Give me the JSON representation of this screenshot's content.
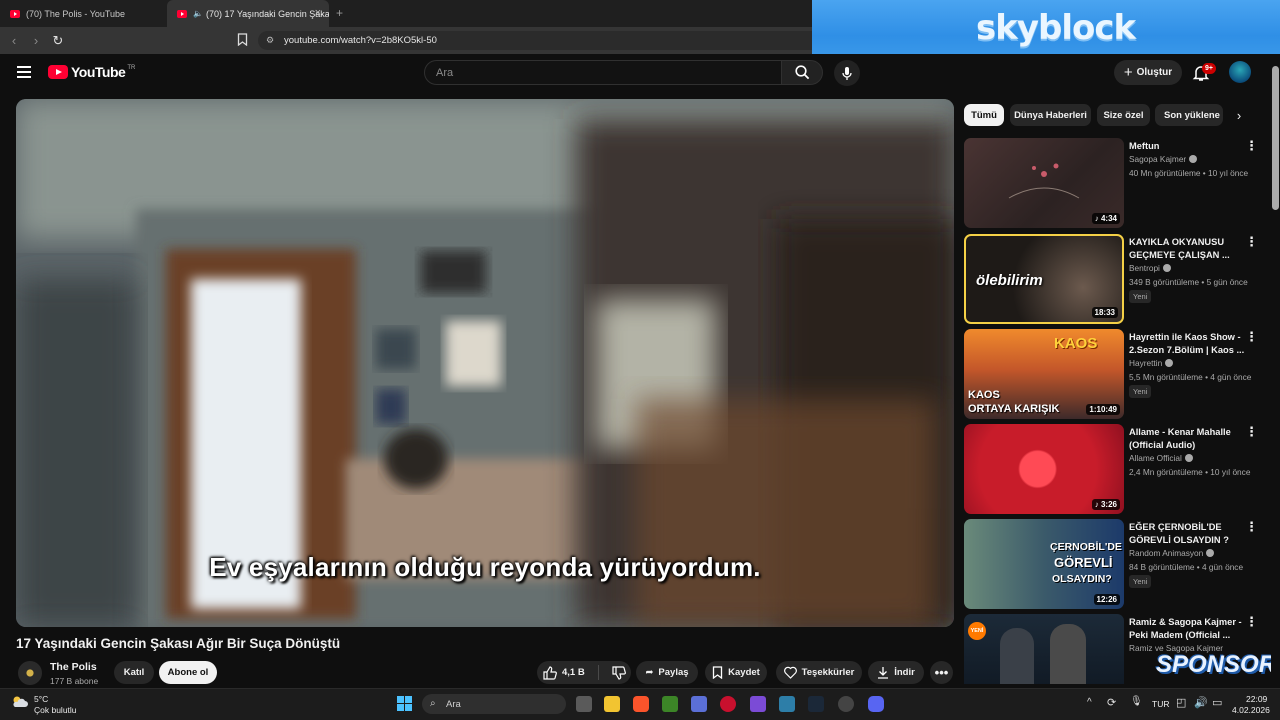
{
  "browser": {
    "tabs": [
      {
        "label": "(70) The Polis - YouTube"
      },
      {
        "label": "(70) 17 Yaşındaki Gencin Şaka"
      }
    ],
    "url": "youtube.com/watch?v=2b8KO5kl-50"
  },
  "overlay": {
    "skyblock_text": "skyblock",
    "sponsor_text": "SPONSOR"
  },
  "header": {
    "logo_text": "YouTube",
    "country_code": "TR",
    "search_placeholder": "Ara",
    "create_label": "Oluştur",
    "notification_count": "9+"
  },
  "video": {
    "subtitle": "Ev eşyalarının olduğu reyonda yürüyordum.",
    "title": "17 Yaşındaki Gencin Şakası Ağır Bir Suça Dönüştü",
    "channel_name": "The Polis",
    "subscribers": "177 B abone",
    "join_label": "Katıl",
    "subscribe_label": "Abone ol",
    "likes": "4,1 B",
    "share_label": "Paylaş",
    "save_label": "Kaydet",
    "thanks_label": "Teşekkürler",
    "download_label": "İndir"
  },
  "chips": [
    "Tümü",
    "Dünya Haberleri",
    "Size özel",
    "Son yüklene"
  ],
  "recommendations": [
    {
      "title": "Meftun",
      "channel": "Sagopa Kajmer",
      "meta": "40 Mn görüntüleme • 10 yıl önce",
      "duration": "4:34",
      "new": ""
    },
    {
      "title": "KAYIKLA OKYANUSU GEÇMEYE ÇALIŞAN ...",
      "channel": "Bentropi",
      "meta": "349 B görüntüleme • 5 gün önce",
      "duration": "18:33",
      "new": "Yeni",
      "thumb_text": "ölebilirim"
    },
    {
      "title": "Hayrettin ile Kaos Show - 2.Sezon 7.Bölüm | Kaos ...",
      "channel": "Hayrettin",
      "meta": "5,5 Mn görüntüleme • 4 gün önce",
      "duration": "1:10:49",
      "new": "Yeni",
      "thumb_text_top": "KAOS",
      "thumb_text_1": "KAOS",
      "thumb_text_2": "ORTAYA KARIŞIK"
    },
    {
      "title": "Allame - Kenar Mahalle (Official Audio)",
      "channel": "Allame Official",
      "meta": "2,4 Mn görüntüleme • 10 yıl önce",
      "duration": "3:26",
      "new": ""
    },
    {
      "title": "EĞER ÇERNOBİL'DE GÖREVLİ OLSAYDIN ?",
      "channel": "Random Animasyon",
      "meta": "84 B görüntüleme • 4 gün önce",
      "duration": "12:26",
      "new": "Yeni",
      "thumb_text_1": "ÇERNOBİL'DE",
      "thumb_text_2": "GÖREVLİ",
      "thumb_text_3": "OLSAYDIN?"
    },
    {
      "title": "Ramiz & Sagopa Kajmer - Peki Madem (Official ...",
      "channel": "Ramiz ve Sagopa Kajmer",
      "meta": "",
      "duration": "",
      "new": "",
      "thumb_badge": "YENİ"
    }
  ],
  "taskbar": {
    "temperature": "5°C",
    "weather": "Çok bulutlu",
    "search_label": "Ara",
    "language": "TUR",
    "time": "22:09",
    "date": "4.02.2026"
  },
  "colors": {
    "youtube_red": "#ff0033",
    "background": "#0f0f0f",
    "chip_bg": "#272727",
    "accent_blue": "#3ea6ff"
  }
}
